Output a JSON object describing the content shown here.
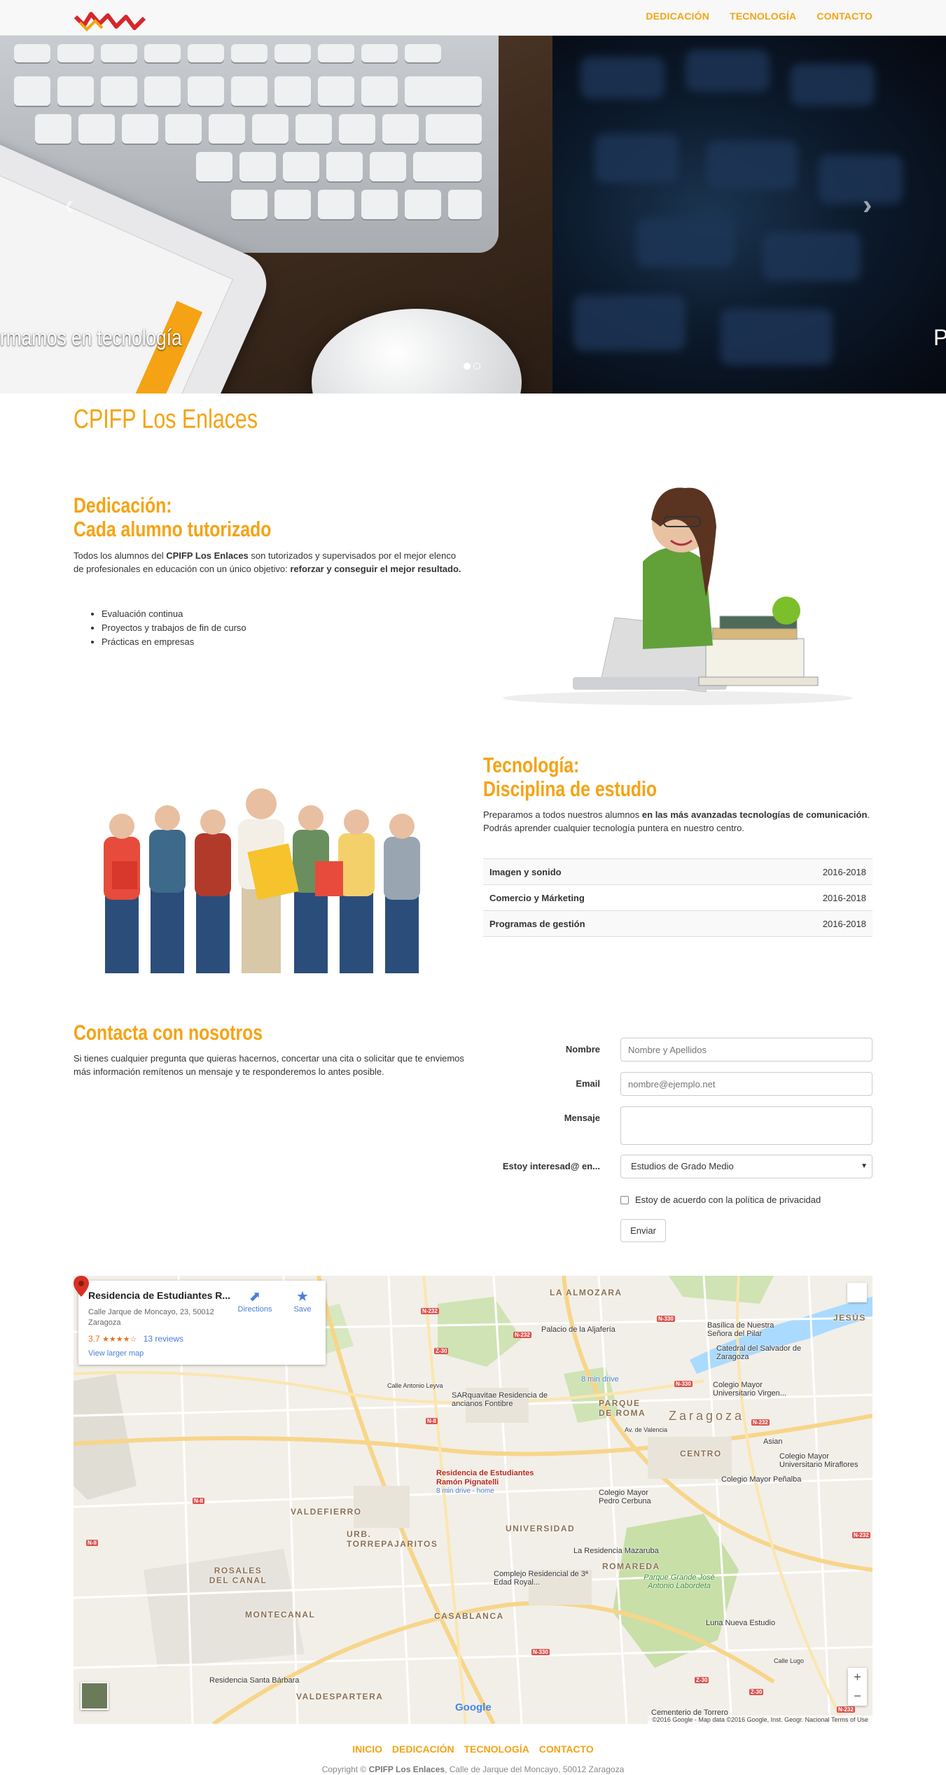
{
  "nav": {
    "links": [
      "DEDICACIÓN",
      "TECNOLOGÍA",
      "CONTACTO"
    ]
  },
  "carousel": {
    "caption_left": "rmamos en tecnología",
    "caption_right": "P",
    "prev_icon": "chevron-left-icon",
    "next_icon": "chevron-right-icon",
    "slide_count": 2,
    "active_slide": 1
  },
  "site_title": "CPIFP Los Enlaces",
  "dedicacion": {
    "heading_line1": "Dedicación:",
    "heading_line2": "Cada alumno tutorizado",
    "text_a": "Todos los alumnos del ",
    "text_b": "CPIFP Los Enlaces",
    "text_c": " son tutorizados y supervisados por el mejor elenco de profesionales en educación con un único objetivo: ",
    "text_d": "reforzar y conseguir el mejor resultado.",
    "items": [
      "Evaluación continua",
      "Proyectos y trabajos de fin de curso",
      "Prácticas en empresas"
    ]
  },
  "tecnologia": {
    "heading_line1": "Tecnología:",
    "heading_line2": "Disciplina de estudio",
    "text_a": "Preparamos a todos nuestros alumnos ",
    "text_b": "en las más avanzadas tecnologías de comunicación",
    "text_c": ". Podrás aprender cualquier tecnología puntera en nuestro centro.",
    "courses": [
      {
        "name": "Imagen y sonido",
        "years": "2016-2018"
      },
      {
        "name": "Comercio y Márketing",
        "years": "2016-2018"
      },
      {
        "name": "Programas de gestión",
        "years": "2016-2018"
      }
    ]
  },
  "contacto": {
    "heading": "Contacta con nosotros",
    "text": "Si tienes cualquier pregunta que quieras hacernos, concertar una cita o solicitar que te enviemos más información remítenos un mensaje y te responderemos lo antes posible.",
    "form": {
      "name_label": "Nombre",
      "name_placeholder": "Nombre y Apellidos",
      "email_label": "Email",
      "email_placeholder": "nombre@ejemplo.net",
      "message_label": "Mensaje",
      "interest_label": "Estoy interesad@ en...",
      "interest_value": "Estudios de Grado Medio",
      "privacy_label": "Estoy de acuerdo con la política de privacidad",
      "submit_label": "Enviar"
    }
  },
  "map": {
    "card_title": "Residencia de Estudiantes R...",
    "card_address": "Calle Jarque de Moncayo, 23, 50012 Zaragoza",
    "rating": "3.7",
    "stars": "★★★★☆",
    "reviews": "13 reviews",
    "larger_map": "View larger map",
    "directions": "Directions",
    "save": "Save",
    "pin_label_1": "Residencia de Estudiantes",
    "pin_label_2": "Ramón Pignatelli",
    "pin_drive": "8 min drive - home",
    "drive_badge": "8 min drive",
    "attribution": "©2016 Google - Map data ©2016 Google, Inst. Geogr. Nacional    Terms of Use",
    "google": "Google",
    "zoom_in": "+",
    "zoom_out": "−",
    "labels": {
      "almozara": "LA ALMOZARA",
      "jesus": "JESÚS",
      "basilica": "Basílica de Nuestra Señora del Pilar",
      "catedral": "Catedral del Salvador de Zaragoza",
      "aljaferia": "Palacio de la Aljafería",
      "sarquavitae": "SARquavitae Residencia de ancianos Fontibre",
      "parque_roma": "PARQUE DE ROMA",
      "zaragoza": "Zaragoza",
      "virgen": "Colegio Mayor Universitario Virgen...",
      "centro": "CENTRO",
      "asian": "Asian",
      "miraflores": "Colegio Mayor Universitario Miraflores",
      "penalba": "Colegio Mayor Peñalba",
      "cerbuna": "Colegio Mayor Pedro Cerbuna",
      "valdefierro": "VALDEFIERRO",
      "torrepajaritos": "URB. TORREPAJARITOS",
      "universidad": "UNIVERSIDAD",
      "mazaruba": "La Residencia Mazaruba",
      "romareda": "ROMAREDA",
      "complejo": "Complejo Residencial de 3ª Edad Royal...",
      "parque_grande": "Parque Grande José Antonio Labordeta",
      "rosales": "ROSALES DEL CANAL",
      "montecanal": "MONTECANAL",
      "casablanca": "CASABLANCA",
      "luna": "Luna Nueva Estudio",
      "santa_barbara": "Residencia Santa Bárbara",
      "valdespartera": "VALDESPARTERA",
      "cementerio": "Cementerio de Torrero",
      "calle_leyva": "Calle Antonio Leyva",
      "av_valencia": "Av. de Valencia",
      "calle_lugo": "Calle Lugo"
    },
    "roads": [
      "N-232",
      "N-232",
      "Z-30",
      "N-330",
      "N-330",
      "N-232",
      "N-II",
      "N-II",
      "N-II",
      "N-330",
      "Z-30",
      "Z-30",
      "N-232",
      "N-232"
    ]
  },
  "footer": {
    "links": [
      "INICIO",
      "DEDICACIÓN",
      "TECNOLOGÍA",
      "CONTACTO"
    ],
    "copyright_a": "Copyright © ",
    "copyright_b": "CPIFP Los Enlaces",
    "copyright_c": ", Calle de Jarque del Moncayo, 50012 Zaragoza"
  },
  "colors": {
    "accent": "#f5a314",
    "nav_bg": "#f8f8f8"
  }
}
